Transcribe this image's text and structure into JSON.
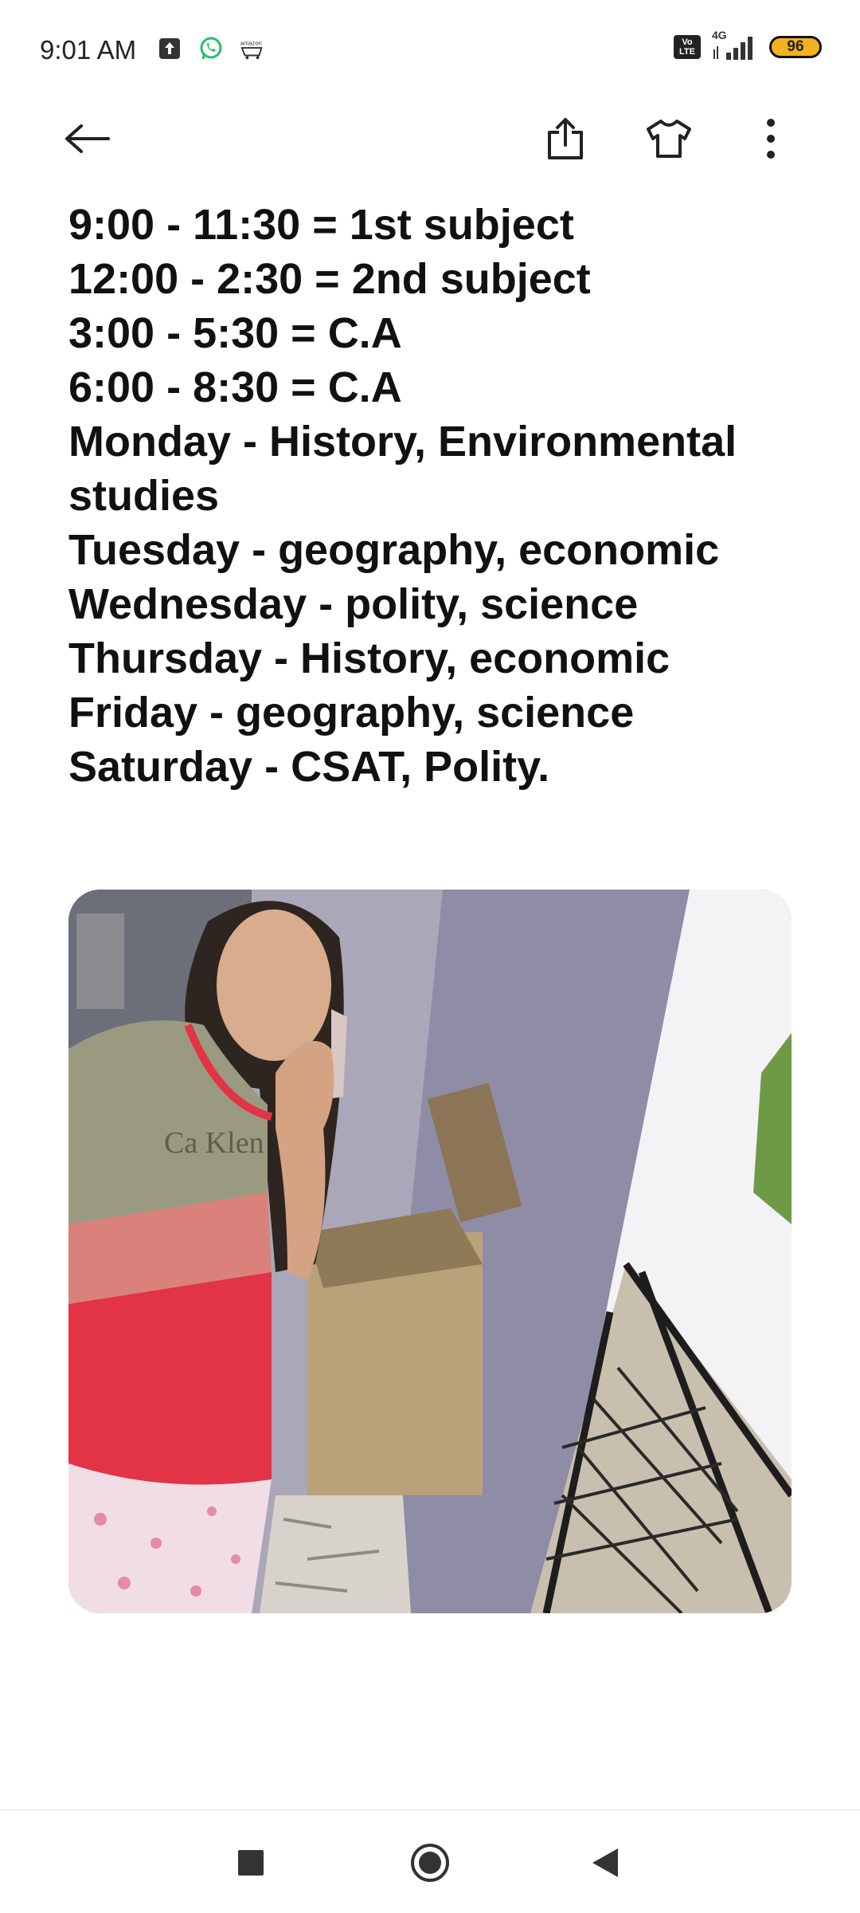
{
  "status_bar": {
    "time": "9:01 AM",
    "left_icons": [
      "upload-notification-icon",
      "whatsapp-icon",
      "amazon-icon"
    ],
    "network": "4G",
    "volte": "Vo LTE",
    "battery": "96",
    "battery_color": "#f2b21d"
  },
  "toolbar": {
    "icons": [
      "back-arrow-icon",
      "share-icon",
      "tshirt-theme-icon",
      "more-vert-icon"
    ]
  },
  "note": {
    "lines": [
      "9:00 - 11:30 = 1st subject",
      "12:00 - 2:30 = 2nd subject",
      "3:00 - 5:30 = C.A",
      "6:00 - 8:30 = C.A",
      "Monday - History, Environmental",
      "studies",
      "Tuesday - geography, economic",
      "Wednesday - polity, science",
      "Thursday - History, economic",
      "Friday - geography, science",
      "Saturday - CSAT, Polity."
    ]
  },
  "image": {
    "content": "photo-attachment",
    "text_on_shirt": "Ca Klen"
  },
  "nav_bar": {
    "icons": [
      "recents-square-icon",
      "home-circle-icon",
      "back-triangle-icon"
    ]
  }
}
